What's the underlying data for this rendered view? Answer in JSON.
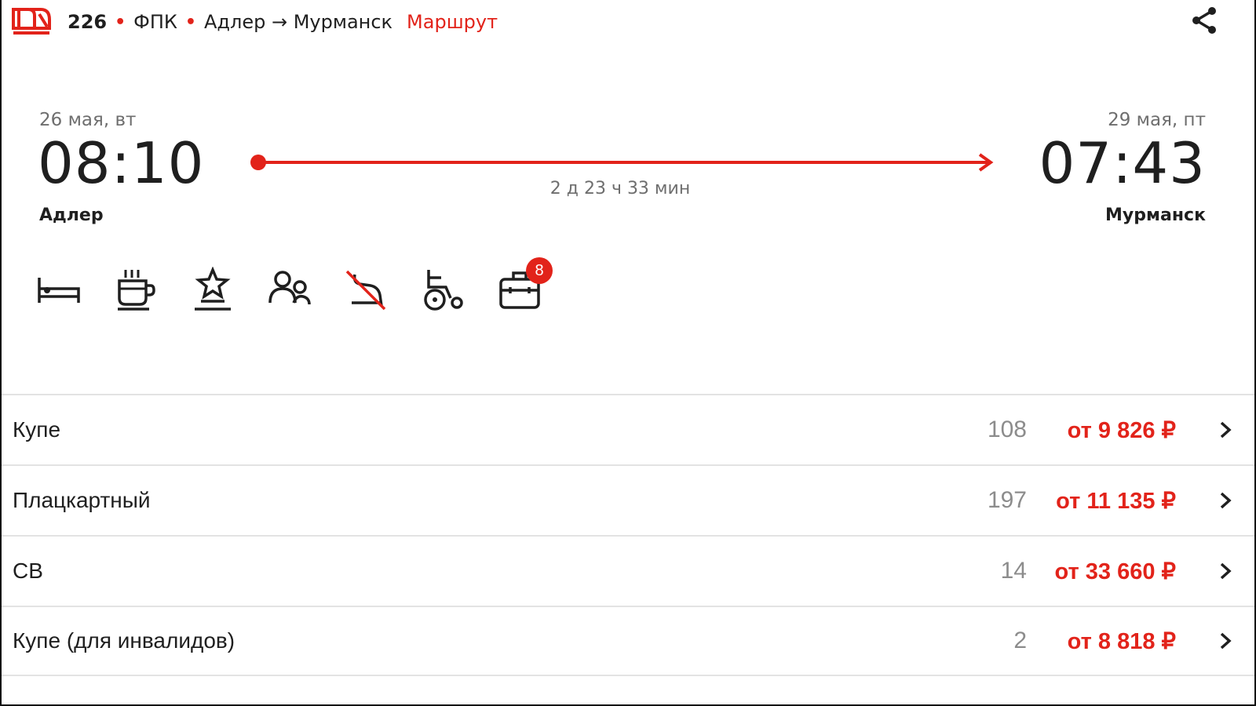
{
  "header": {
    "train_number": "226",
    "carrier": "ФПК",
    "route": "Адлер → Мурманск",
    "route_link": "Маршрут"
  },
  "departure": {
    "date": "26 мая, вт",
    "time": "08:10",
    "station": "Адлер"
  },
  "arrival": {
    "date": "29 мая, пт",
    "time": "07:43",
    "station": "Мурманск"
  },
  "duration": "2 д 23 ч 33 мин",
  "services": [
    {
      "icon": "bed-icon"
    },
    {
      "icon": "coffee-icon"
    },
    {
      "icon": "award-icon"
    },
    {
      "icon": "people-icon"
    },
    {
      "icon": "no-pets-icon"
    },
    {
      "icon": "wheelchair-icon"
    },
    {
      "icon": "luggage-icon",
      "badge": "8"
    }
  ],
  "classes": [
    {
      "name": "Купе",
      "seats": "108",
      "price": "от 9 826 ₽"
    },
    {
      "name": "Плацкартный",
      "seats": "197",
      "price": "от 11 135 ₽"
    },
    {
      "name": "СВ",
      "seats": "14",
      "price": "от 33 660 ₽"
    },
    {
      "name": "Купе (для инвалидов)",
      "seats": "2",
      "price": "от 8 818 ₽"
    }
  ],
  "colors": {
    "accent": "#e2231a",
    "text": "#1f1f1f",
    "muted": "#6e6e6e"
  }
}
